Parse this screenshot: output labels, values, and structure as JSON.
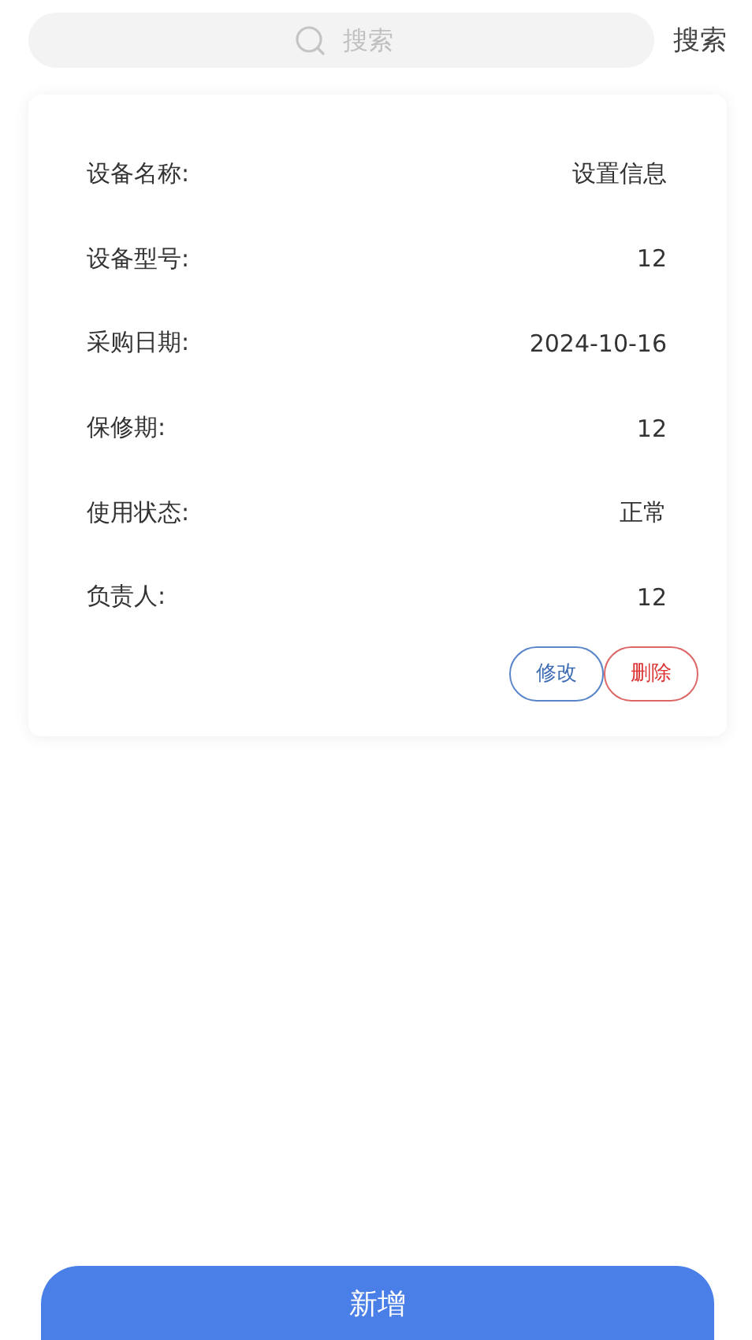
{
  "search": {
    "placeholder": "搜索",
    "button": "搜索"
  },
  "device": {
    "fields": [
      {
        "label": "设备名称:",
        "value": "设置信息"
      },
      {
        "label": "设备型号:",
        "value": "12"
      },
      {
        "label": "采购日期:",
        "value": "2024-10-16"
      },
      {
        "label": "保修期:",
        "value": "12"
      },
      {
        "label": "使用状态:",
        "value": "正常"
      },
      {
        "label": "负责人:",
        "value": "12"
      }
    ],
    "actions": [
      {
        "label": "修改",
        "kind": "edit"
      },
      {
        "label": "删除",
        "kind": "delete"
      }
    ]
  },
  "add_button": "新增"
}
